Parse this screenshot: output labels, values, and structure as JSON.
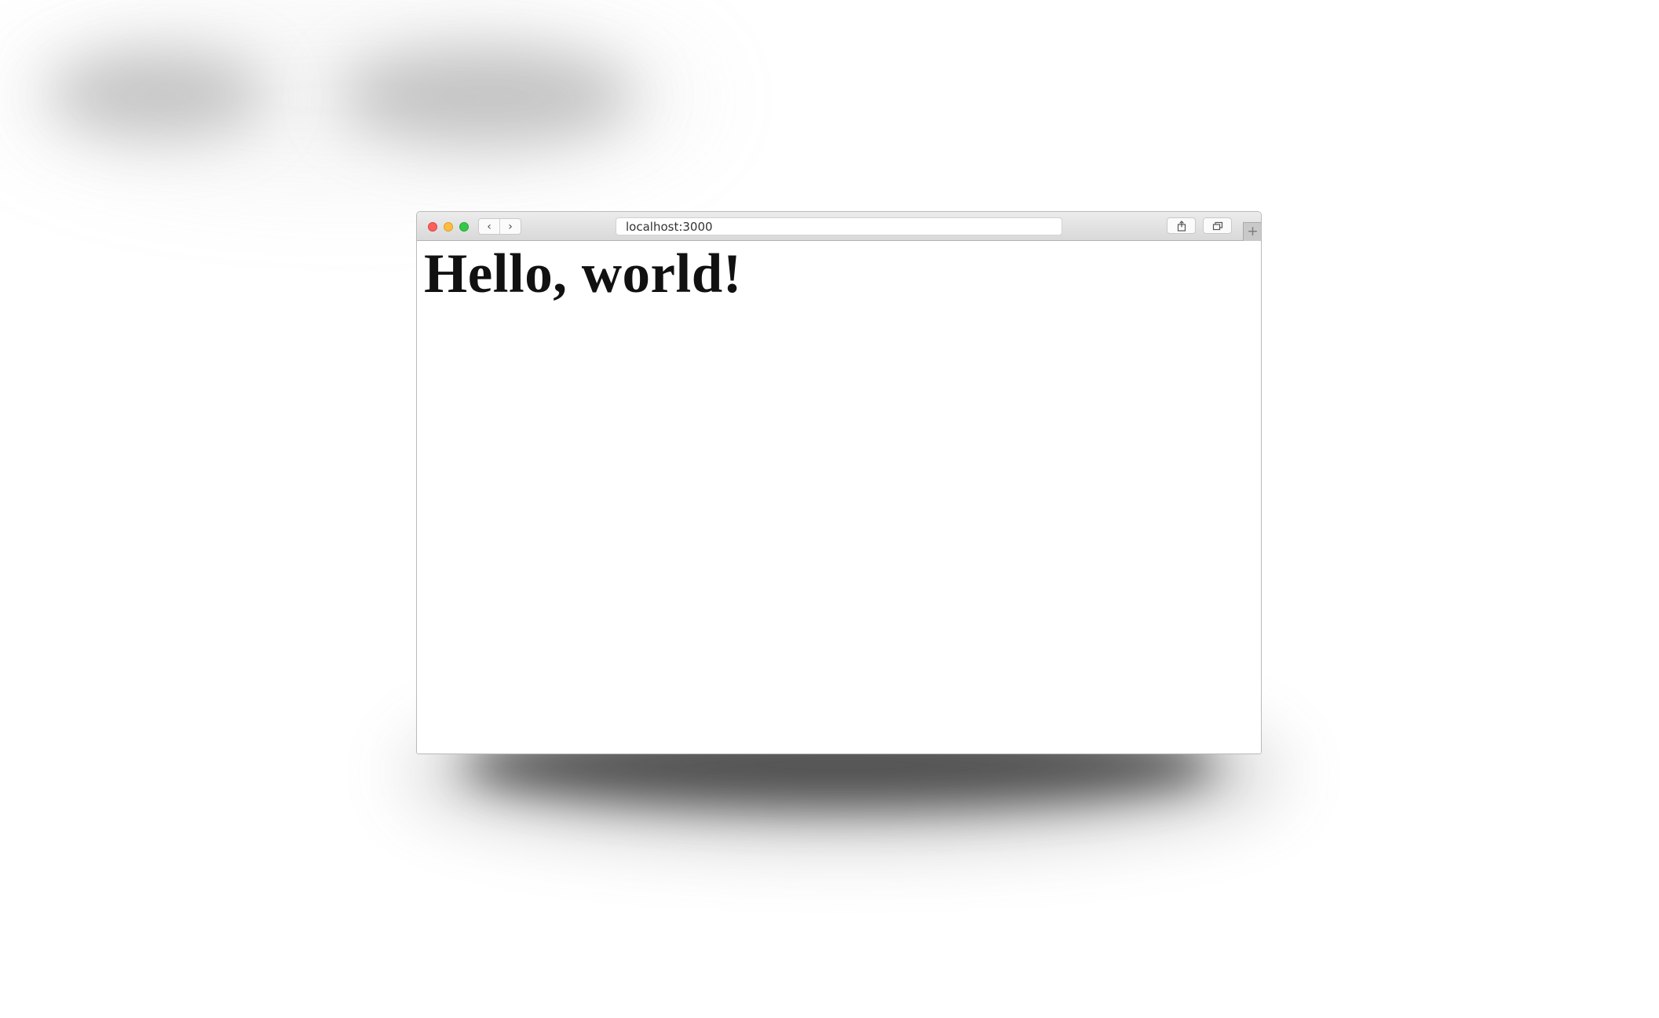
{
  "browser": {
    "address_text": "localhost:3000",
    "nav_back_glyph": "‹",
    "nav_forward_glyph": "›",
    "new_tab_glyph": "+",
    "icons": {
      "close": "close-icon",
      "minimize": "minimize-icon",
      "maximize": "maximize-icon",
      "share": "share-icon",
      "tabs": "tabs-overview-icon"
    },
    "colors": {
      "close": "#fc605c",
      "minimize": "#fdbc40",
      "maximize": "#34c84a"
    }
  },
  "page": {
    "heading": "Hello, world!"
  }
}
